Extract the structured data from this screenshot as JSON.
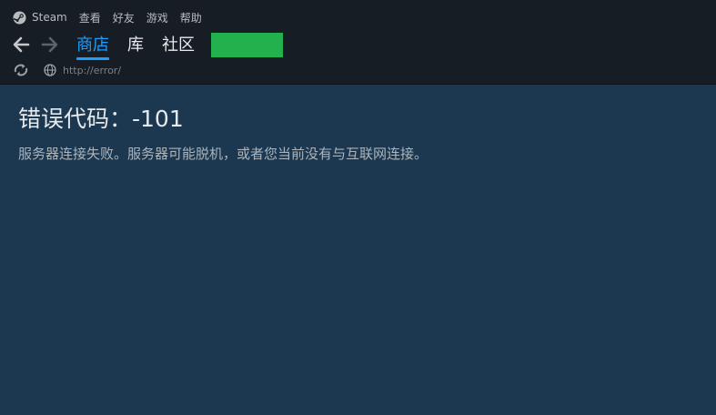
{
  "menubar": {
    "app_label": "Steam",
    "items": [
      "查看",
      "好友",
      "游戏",
      "帮助"
    ]
  },
  "nav": {
    "tabs": [
      {
        "label": "商店",
        "active": true
      },
      {
        "label": "库",
        "active": false
      },
      {
        "label": "社区",
        "active": false
      }
    ]
  },
  "address": {
    "url": "http://error/"
  },
  "error": {
    "title": "错误代码：-101",
    "message": "服务器连接失败。服务器可能脱机，或者您当前没有与互联网连接。"
  },
  "colors": {
    "accent": "#1a9fff",
    "user_block": "#23b14d",
    "content_bg": "#1b3850",
    "chrome_bg": "#171d25"
  },
  "icons": {
    "logo": "steam-logo-icon",
    "back": "back-arrow-icon",
    "forward": "forward-arrow-icon",
    "reload": "reload-icon",
    "site": "globe-icon"
  }
}
